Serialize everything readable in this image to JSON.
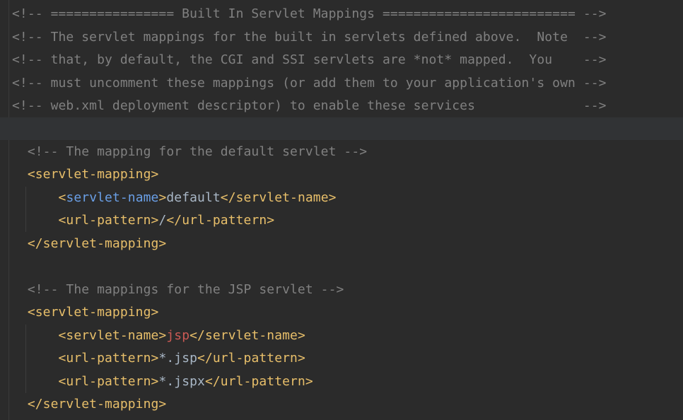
{
  "lines": {
    "l1": "<!-- ================ Built In Servlet Mappings ========================= -->",
    "l2": "<!-- The servlet mappings for the built in servlets defined above.  Note  -->",
    "l3": "<!-- that, by default, the CGI and SSI servlets are *not* mapped.  You    -->",
    "l4": "<!-- must uncomment these mappings (or add them to your application's own -->",
    "l5": "<!-- web.xml deployment descriptor) to enable these services              -->",
    "l7": "  <!-- The mapping for the default servlet -->",
    "l8_open": "  <servlet-mapping>",
    "l9_indent": "      ",
    "l9_lt": "<",
    "l9_tag": "servlet-name",
    "l9_gt": ">",
    "l9_val": "default",
    "l9_close": "</servlet-name>",
    "l10_indent": "      ",
    "l10_open": "<url-pattern>",
    "l10_val": "/",
    "l10_close": "</url-pattern>",
    "l11_close": "  </servlet-mapping>",
    "l13": "  <!-- The mappings for the JSP servlet -->",
    "l14_open": "  <servlet-mapping>",
    "l15_indent": "      ",
    "l15_open": "<servlet-name>",
    "l15_val": "jsp",
    "l15_close": "</servlet-name>",
    "l16_indent": "      ",
    "l16_open": "<url-pattern>",
    "l16_val": "*.jsp",
    "l16_close": "</url-pattern>",
    "l17_indent": "      ",
    "l17_open": "<url-pattern>",
    "l17_val": "*.jspx",
    "l17_close": "</url-pattern>",
    "l18_close": "  </servlet-mapping>"
  },
  "colors": {
    "background": "#2b2b2b",
    "comment": "#808080",
    "tag": "#e8bf6a",
    "tag_name_highlight": "#6a9fe6",
    "text": "#a9b7c6",
    "value_highlight": "#cc5a54"
  }
}
